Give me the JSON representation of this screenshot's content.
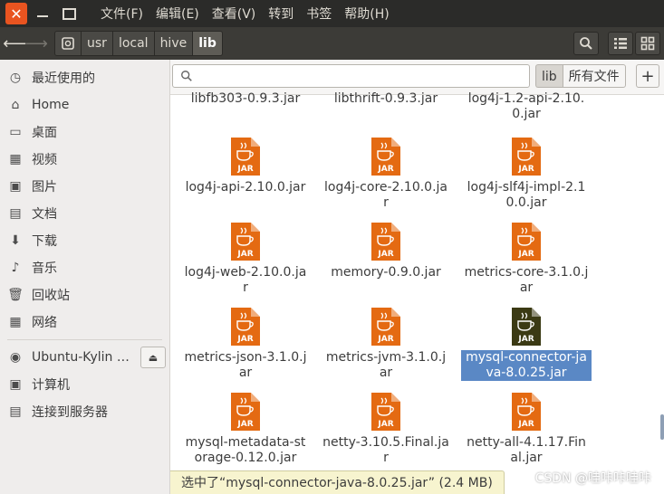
{
  "menubar": {
    "items": [
      "文件(F)",
      "编辑(E)",
      "查看(V)",
      "转到",
      "书签",
      "帮助(H)"
    ]
  },
  "toolbar": {
    "path": [
      "usr",
      "local",
      "hive",
      "lib"
    ],
    "active_segment": "lib"
  },
  "sidebar": {
    "places": [
      {
        "label": "最近使用的",
        "icon": "clock-icon"
      },
      {
        "label": "Home",
        "icon": "home-icon"
      },
      {
        "label": "桌面",
        "icon": "desktop-icon"
      },
      {
        "label": "视频",
        "icon": "video-icon"
      },
      {
        "label": "图片",
        "icon": "picture-icon"
      },
      {
        "label": "文档",
        "icon": "document-icon"
      },
      {
        "label": "下载",
        "icon": "download-icon"
      },
      {
        "label": "音乐",
        "icon": "music-icon"
      },
      {
        "label": "回收站",
        "icon": "trash-icon"
      },
      {
        "label": "网络",
        "icon": "network-icon"
      }
    ],
    "devices": [
      {
        "label": "Ubuntu-Kylin 1…",
        "icon": "disc-icon",
        "eject": true
      },
      {
        "label": "计算机",
        "icon": "computer-icon"
      },
      {
        "label": "连接到服务器",
        "icon": "server-icon"
      }
    ]
  },
  "search": {
    "placeholder": "",
    "scope_current": "lib",
    "scope_all": "所有文件"
  },
  "files": [
    {
      "name": "libfb303-0.9.3.jar",
      "partial": true
    },
    {
      "name": "libthrift-0.9.3.jar",
      "partial": true
    },
    {
      "name": "log4j-1.2-api-2.10.0.jar",
      "partial": true
    },
    {
      "name": "log4j-api-2.10.0.jar"
    },
    {
      "name": "log4j-core-2.10.0.jar"
    },
    {
      "name": "log4j-slf4j-impl-2.10.0.jar"
    },
    {
      "name": "log4j-web-2.10.0.jar"
    },
    {
      "name": "memory-0.9.0.jar"
    },
    {
      "name": "metrics-core-3.1.0.jar"
    },
    {
      "name": "metrics-json-3.1.0.jar"
    },
    {
      "name": "metrics-jvm-3.1.0.jar"
    },
    {
      "name": "mysql-connector-java-8.0.25.jar",
      "selected": true
    },
    {
      "name": "mysql-metadata-storage-0.12.0.jar"
    },
    {
      "name": "netty-3.10.5.Final.jar"
    },
    {
      "name": "netty-all-4.1.17.Final.jar"
    }
  ],
  "file_icon_label": "JAR",
  "colors": {
    "jar_orange": "#e46a12",
    "jar_selected": "#3b3a14",
    "selection_blue": "#5a88c5",
    "close_orange": "#e95420"
  },
  "status": {
    "text": "选中了“mysql-connector-java-8.0.25.jar” (2.4 MB)"
  },
  "watermark": "CSDN @哇咔咔哇咔"
}
